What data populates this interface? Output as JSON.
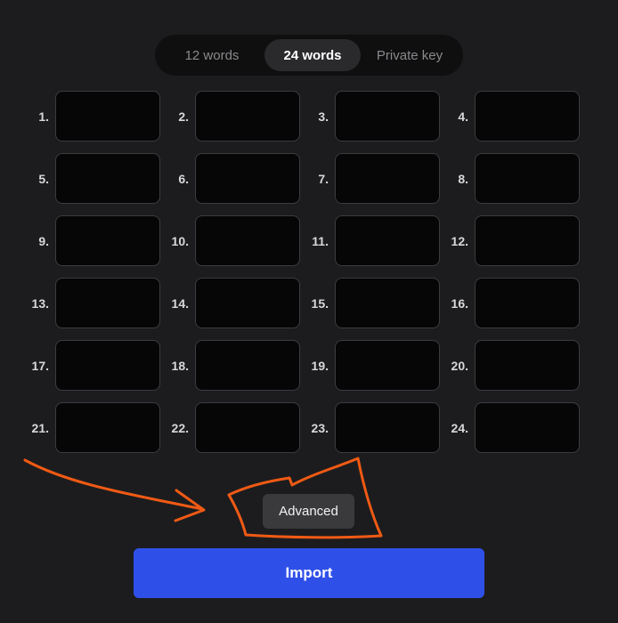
{
  "tabs": [
    {
      "label": "12 words",
      "selected": false
    },
    {
      "label": "24 words",
      "selected": true
    },
    {
      "label": "Private key",
      "selected": false
    }
  ],
  "words": [
    {
      "n": "1.",
      "value": ""
    },
    {
      "n": "2.",
      "value": ""
    },
    {
      "n": "3.",
      "value": ""
    },
    {
      "n": "4.",
      "value": ""
    },
    {
      "n": "5.",
      "value": ""
    },
    {
      "n": "6.",
      "value": ""
    },
    {
      "n": "7.",
      "value": ""
    },
    {
      "n": "8.",
      "value": ""
    },
    {
      "n": "9.",
      "value": ""
    },
    {
      "n": "10.",
      "value": ""
    },
    {
      "n": "11.",
      "value": ""
    },
    {
      "n": "12.",
      "value": ""
    },
    {
      "n": "13.",
      "value": ""
    },
    {
      "n": "14.",
      "value": ""
    },
    {
      "n": "15.",
      "value": ""
    },
    {
      "n": "16.",
      "value": ""
    },
    {
      "n": "17.",
      "value": ""
    },
    {
      "n": "18.",
      "value": ""
    },
    {
      "n": "19.",
      "value": ""
    },
    {
      "n": "20.",
      "value": ""
    },
    {
      "n": "21.",
      "value": ""
    },
    {
      "n": "22.",
      "value": ""
    },
    {
      "n": "23.",
      "value": ""
    },
    {
      "n": "24.",
      "value": ""
    }
  ],
  "advanced_label": "Advanced",
  "import_label": "Import",
  "colors": {
    "background": "#1c1c1e",
    "accent": "#2f50e8",
    "annotation": "#f05a14"
  }
}
